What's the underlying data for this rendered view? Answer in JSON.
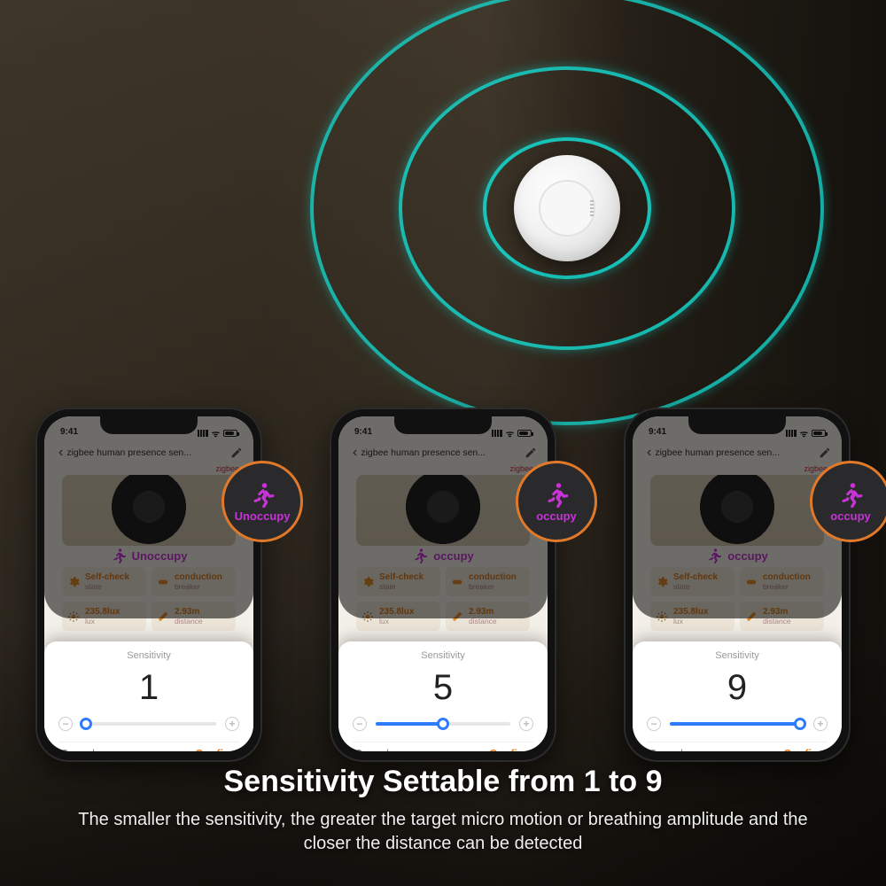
{
  "statusbar_time": "9:41",
  "app_title": "zigbee human presence sen...",
  "protocol_badge": "zigbee",
  "presence_states": {
    "unoccupy": "Unoccupy",
    "occupy": "occupy"
  },
  "tiles": {
    "self_check": {
      "label": "state",
      "title": "Self-check"
    },
    "breaker": {
      "label": "breaker",
      "title": "conduction"
    },
    "lux": {
      "label": "lux",
      "value": "235.8lux"
    },
    "distance": {
      "label": "distance",
      "value": "2.93m"
    }
  },
  "panel": {
    "label": "Sensitivity",
    "cancel": "Cancel",
    "confirm": "Confirm"
  },
  "phones": [
    {
      "value": "1",
      "fill_pct": 3,
      "presence": "unoccupy"
    },
    {
      "value": "5",
      "fill_pct": 50,
      "presence": "occupy"
    },
    {
      "value": "9",
      "fill_pct": 97,
      "presence": "occupy"
    }
  ],
  "headline": "Sensitivity Settable from 1 to 9",
  "subtext": "The smaller the sensitivity, the greater the target micro motion or breathing amplitude and the closer the distance can be detected"
}
